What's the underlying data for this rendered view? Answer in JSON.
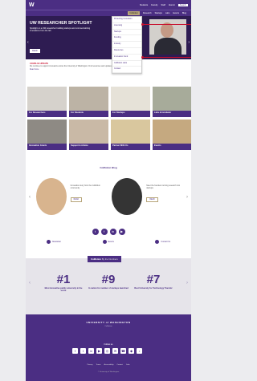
{
  "header": {
    "logo_glyph": "W",
    "logo_text": "W",
    "links": [
      "Students",
      "Faculty",
      "Staff",
      "Alumni",
      "Contact"
    ],
    "search_label": "Search",
    "bag": "Bag"
  },
  "nav": {
    "active": "CoMotion",
    "items": [
      "CoMotion",
      "Research",
      "Startups",
      "Labs",
      "Events",
      "Blog"
    ]
  },
  "hero": {
    "title": "UW RESEARCHER SPOTLIGHT",
    "body": "Spotlight on a UW researcher building startups and commercializing innovations from the lab.",
    "read_more": "READ"
  },
  "dropdown": [
    "Protecting Innovation",
    "Licensing",
    "Startups",
    "Funding",
    "Industry",
    "Resources",
    "Innovation Fund",
    "CoMotion Labs",
    "Contact"
  ],
  "alert": {
    "heading": "COVID-19 UPDATE",
    "body": "We continue to support innovators across the University of Washington. Find resources and updates on how to connect with our team.",
    "more": "Read more"
  },
  "tiles": [
    {
      "label": "For Researchers"
    },
    {
      "label": "For Students"
    },
    {
      "label": "For Startups"
    },
    {
      "label": "Labs & Incubator"
    },
    {
      "label": "Innovation Grants"
    },
    {
      "label": "Support & Advice"
    },
    {
      "label": "Partner With Us"
    },
    {
      "label": "Events"
    }
  ],
  "blog": {
    "title": "CoMotion Blog",
    "cards": [
      {
        "text": "Innovation story from the CoMotion community",
        "button": "READ"
      },
      {
        "text": "Meet the founders turning research into startups",
        "button": "READ"
      }
    ]
  },
  "social": [
    "t",
    "f",
    "in",
    "▶"
  ],
  "minis": [
    "Newsletter",
    "Events",
    "Contact Us"
  ],
  "stats": {
    "badge_main": "CoMotion",
    "badge_sub": "By the Numbers",
    "items": [
      {
        "n": "#1",
        "s": "Most innovative public university in the world"
      },
      {
        "n": "#9",
        "s": "In nation for number of startups launched"
      },
      {
        "n": "#7",
        "s": "Best University for Technology Transfer"
      }
    ]
  },
  "footer": {
    "name": "UNIVERSITY of WASHINGTON",
    "sub": "CoMotion",
    "follow": "Follow us",
    "icons": [
      "f",
      "t",
      "in",
      "▶",
      "◎",
      "✉",
      "☎",
      "◆",
      "♪"
    ],
    "links": [
      "Privacy",
      "Terms",
      "Accessibility",
      "Contact",
      "Jobs"
    ],
    "copy": "© University of Washington"
  },
  "colors": {
    "purple": "#4b2e83",
    "gold": "#b7a57a",
    "red": "#c8102e"
  }
}
